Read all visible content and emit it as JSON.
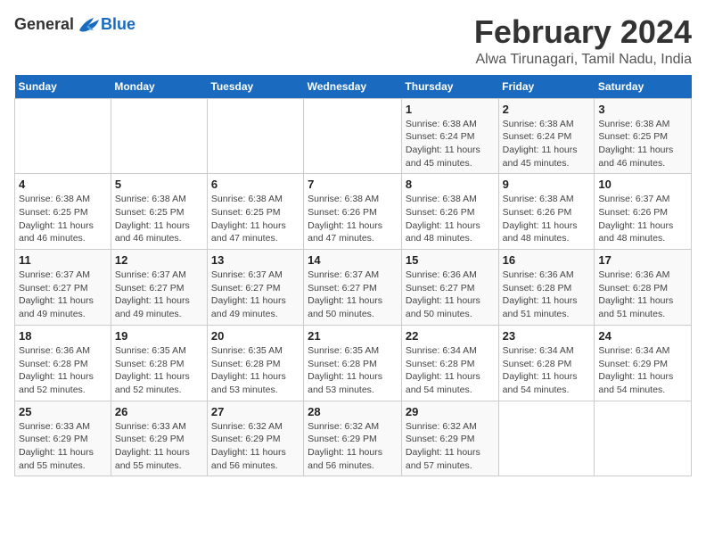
{
  "header": {
    "logo_general": "General",
    "logo_blue": "Blue",
    "title": "February 2024",
    "subtitle": "Alwa Tirunagari, Tamil Nadu, India"
  },
  "calendar": {
    "days_of_week": [
      "Sunday",
      "Monday",
      "Tuesday",
      "Wednesday",
      "Thursday",
      "Friday",
      "Saturday"
    ],
    "weeks": [
      [
        {
          "day": "",
          "info": ""
        },
        {
          "day": "",
          "info": ""
        },
        {
          "day": "",
          "info": ""
        },
        {
          "day": "",
          "info": ""
        },
        {
          "day": "1",
          "info": "Sunrise: 6:38 AM\nSunset: 6:24 PM\nDaylight: 11 hours\nand 45 minutes."
        },
        {
          "day": "2",
          "info": "Sunrise: 6:38 AM\nSunset: 6:24 PM\nDaylight: 11 hours\nand 45 minutes."
        },
        {
          "day": "3",
          "info": "Sunrise: 6:38 AM\nSunset: 6:25 PM\nDaylight: 11 hours\nand 46 minutes."
        }
      ],
      [
        {
          "day": "4",
          "info": "Sunrise: 6:38 AM\nSunset: 6:25 PM\nDaylight: 11 hours\nand 46 minutes."
        },
        {
          "day": "5",
          "info": "Sunrise: 6:38 AM\nSunset: 6:25 PM\nDaylight: 11 hours\nand 46 minutes."
        },
        {
          "day": "6",
          "info": "Sunrise: 6:38 AM\nSunset: 6:25 PM\nDaylight: 11 hours\nand 47 minutes."
        },
        {
          "day": "7",
          "info": "Sunrise: 6:38 AM\nSunset: 6:26 PM\nDaylight: 11 hours\nand 47 minutes."
        },
        {
          "day": "8",
          "info": "Sunrise: 6:38 AM\nSunset: 6:26 PM\nDaylight: 11 hours\nand 48 minutes."
        },
        {
          "day": "9",
          "info": "Sunrise: 6:38 AM\nSunset: 6:26 PM\nDaylight: 11 hours\nand 48 minutes."
        },
        {
          "day": "10",
          "info": "Sunrise: 6:37 AM\nSunset: 6:26 PM\nDaylight: 11 hours\nand 48 minutes."
        }
      ],
      [
        {
          "day": "11",
          "info": "Sunrise: 6:37 AM\nSunset: 6:27 PM\nDaylight: 11 hours\nand 49 minutes."
        },
        {
          "day": "12",
          "info": "Sunrise: 6:37 AM\nSunset: 6:27 PM\nDaylight: 11 hours\nand 49 minutes."
        },
        {
          "day": "13",
          "info": "Sunrise: 6:37 AM\nSunset: 6:27 PM\nDaylight: 11 hours\nand 49 minutes."
        },
        {
          "day": "14",
          "info": "Sunrise: 6:37 AM\nSunset: 6:27 PM\nDaylight: 11 hours\nand 50 minutes."
        },
        {
          "day": "15",
          "info": "Sunrise: 6:36 AM\nSunset: 6:27 PM\nDaylight: 11 hours\nand 50 minutes."
        },
        {
          "day": "16",
          "info": "Sunrise: 6:36 AM\nSunset: 6:28 PM\nDaylight: 11 hours\nand 51 minutes."
        },
        {
          "day": "17",
          "info": "Sunrise: 6:36 AM\nSunset: 6:28 PM\nDaylight: 11 hours\nand 51 minutes."
        }
      ],
      [
        {
          "day": "18",
          "info": "Sunrise: 6:36 AM\nSunset: 6:28 PM\nDaylight: 11 hours\nand 52 minutes."
        },
        {
          "day": "19",
          "info": "Sunrise: 6:35 AM\nSunset: 6:28 PM\nDaylight: 11 hours\nand 52 minutes."
        },
        {
          "day": "20",
          "info": "Sunrise: 6:35 AM\nSunset: 6:28 PM\nDaylight: 11 hours\nand 53 minutes."
        },
        {
          "day": "21",
          "info": "Sunrise: 6:35 AM\nSunset: 6:28 PM\nDaylight: 11 hours\nand 53 minutes."
        },
        {
          "day": "22",
          "info": "Sunrise: 6:34 AM\nSunset: 6:28 PM\nDaylight: 11 hours\nand 54 minutes."
        },
        {
          "day": "23",
          "info": "Sunrise: 6:34 AM\nSunset: 6:28 PM\nDaylight: 11 hours\nand 54 minutes."
        },
        {
          "day": "24",
          "info": "Sunrise: 6:34 AM\nSunset: 6:29 PM\nDaylight: 11 hours\nand 54 minutes."
        }
      ],
      [
        {
          "day": "25",
          "info": "Sunrise: 6:33 AM\nSunset: 6:29 PM\nDaylight: 11 hours\nand 55 minutes."
        },
        {
          "day": "26",
          "info": "Sunrise: 6:33 AM\nSunset: 6:29 PM\nDaylight: 11 hours\nand 55 minutes."
        },
        {
          "day": "27",
          "info": "Sunrise: 6:32 AM\nSunset: 6:29 PM\nDaylight: 11 hours\nand 56 minutes."
        },
        {
          "day": "28",
          "info": "Sunrise: 6:32 AM\nSunset: 6:29 PM\nDaylight: 11 hours\nand 56 minutes."
        },
        {
          "day": "29",
          "info": "Sunrise: 6:32 AM\nSunset: 6:29 PM\nDaylight: 11 hours\nand 57 minutes."
        },
        {
          "day": "",
          "info": ""
        },
        {
          "day": "",
          "info": ""
        }
      ]
    ]
  }
}
